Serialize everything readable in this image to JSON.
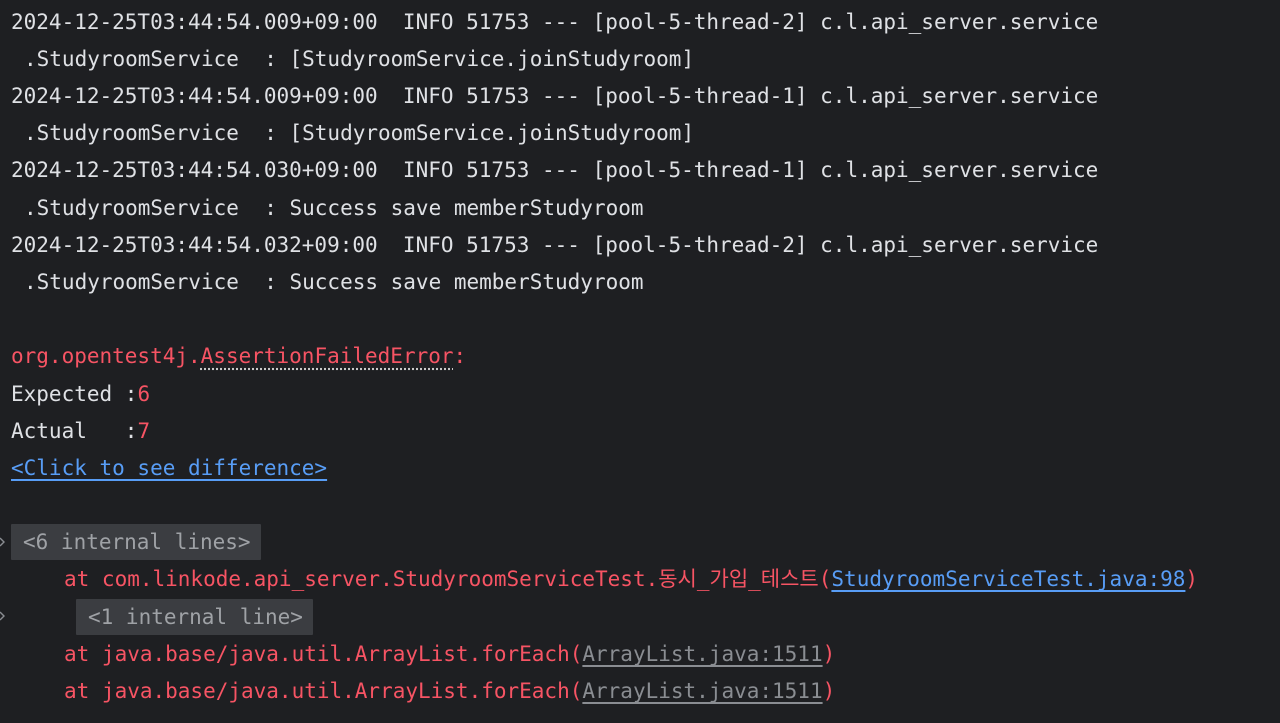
{
  "log_lines": [
    {
      "text": "2024-12-25T03:44:54.009+09:00  INFO 51753 --- [pool-5-thread-2] c.l.api_server.service"
    },
    {
      "text": ".StudyroomService  : [StudyroomService.joinStudyroom]"
    },
    {
      "text": "2024-12-25T03:44:54.009+09:00  INFO 51753 --- [pool-5-thread-1] c.l.api_server.service"
    },
    {
      "text": ".StudyroomService  : [StudyroomService.joinStudyroom]"
    },
    {
      "text": "2024-12-25T03:44:54.030+09:00  INFO 51753 --- [pool-5-thread-1] c.l.api_server.service"
    },
    {
      "text": ".StudyroomService  : Success save memberStudyroom"
    },
    {
      "text": "2024-12-25T03:44:54.032+09:00  INFO 51753 --- [pool-5-thread-2] c.l.api_server.service"
    },
    {
      "text": ".StudyroomService  : Success save memberStudyroom"
    }
  ],
  "error": {
    "package": "org.opentest4j.",
    "class_name": "AssertionFailedError",
    "colon": ":",
    "expected_label": "Expected :",
    "expected_value": "6",
    "actual_label": "Actual   :",
    "actual_value": "7",
    "diff_link": "<Click to see difference>"
  },
  "stack": {
    "fold_1": "<6 internal lines>",
    "frame_1_prefix": "at com.linkode.api_server.StudyroomServiceTest.동시_가입_테스트(",
    "frame_1_link": "StudyroomServiceTest.java:98",
    "frame_1_suffix": ")",
    "fold_2": "<1 internal line>",
    "frame_2_prefix": "at java.base/java.util.ArrayList.forEach(",
    "frame_2_link": "ArrayList.java:1511",
    "frame_2_suffix": ")",
    "frame_3_prefix": "at java.base/java.util.ArrayList.forEach(",
    "frame_3_link": "ArrayList.java:1511",
    "frame_3_suffix": ")"
  },
  "icons": {
    "fold_chevron": "chevron-right-icon"
  },
  "colors": {
    "background": "#1e1f22",
    "text": "#dfe1e5",
    "error": "#f75464",
    "link": "#589df6",
    "link_gray": "#8a8d92",
    "fold_bg": "#3b3d41"
  }
}
